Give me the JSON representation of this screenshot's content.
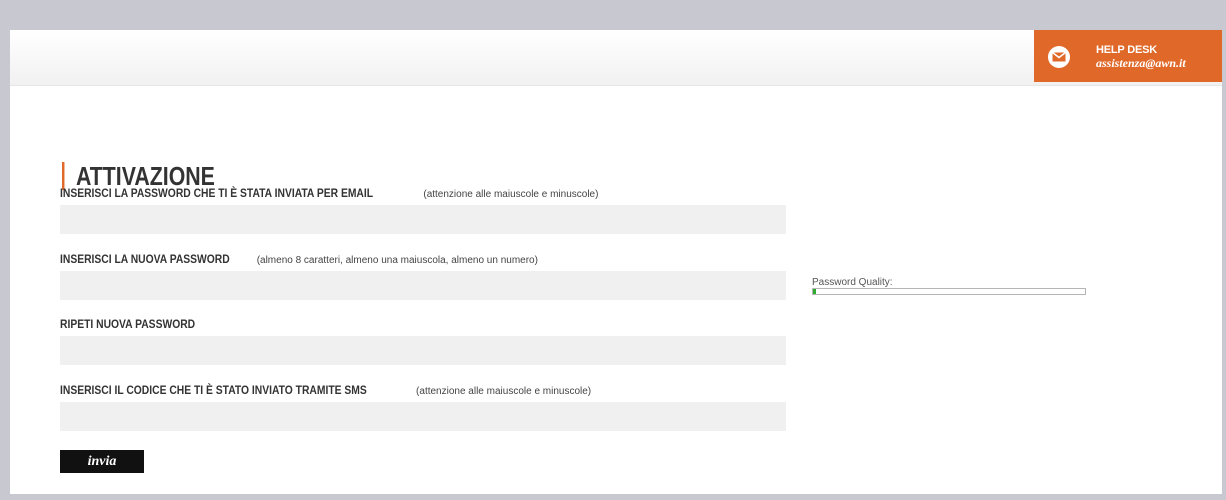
{
  "header": {
    "helpdesk": {
      "title": "HELP DESK",
      "email": "assistenza@awn.it",
      "icon": "mail-icon",
      "color": "#e0692a"
    }
  },
  "form": {
    "title": "ATTIVAZIONE",
    "fields": [
      {
        "label": "INSERISCI LA PASSWORD CHE TI È STATA INVIATA PER EMAIL",
        "note": "(attenzione alle maiuscole e minuscole)",
        "value": ""
      },
      {
        "label": "INSERISCI LA NUOVA PASSWORD",
        "note": "(almeno 8 caratteri, almeno una maiuscola, almeno un numero)",
        "value": ""
      },
      {
        "label": "RIPETI NUOVA PASSWORD",
        "note": "",
        "value": ""
      },
      {
        "label": "INSERISCI IL CODICE CHE TI È STATO INVIATO TRAMITE SMS",
        "note": "(attenzione alle maiuscole e minuscole)",
        "value": ""
      }
    ],
    "password_quality": {
      "label": "Password Quality:",
      "level": 0.01,
      "color": "#2eaa2e"
    },
    "submit_label": "invia"
  }
}
